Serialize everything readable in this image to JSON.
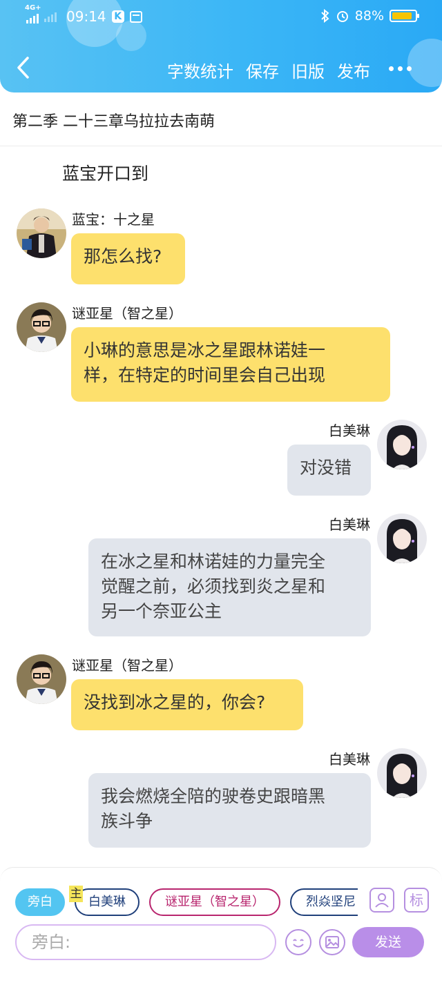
{
  "status_bar": {
    "network": "4G+",
    "time": "09:14",
    "k_icon": "K",
    "battery": "88%",
    "battery_level": 0.88
  },
  "header": {
    "actions": [
      "字数统计",
      "保存",
      "旧版",
      "发布"
    ]
  },
  "chapter_title": "第二季 二十三章乌拉拉去南萌",
  "narration": "蓝宝开口到",
  "messages": [
    {
      "speaker": "蓝宝：十之星",
      "text": "那怎么找?",
      "side": "left"
    },
    {
      "speaker": "谜亚星（智之星）",
      "line1": "小琳的意思是冰之星跟林诺娃一",
      "line2": "样，在特定的时间里会自己出现",
      "side": "left"
    },
    {
      "speaker": "白美琳",
      "text": "对没错",
      "side": "right"
    },
    {
      "speaker": "白美琳",
      "line1": "在冰之星和林诺娃的力量完全",
      "line2": "觉醒之前，必须找到炎之星和",
      "line3": "另一个奈亚公主",
      "side": "right"
    },
    {
      "speaker": "谜亚星（智之星）",
      "text": "没找到冰之星的，你会?",
      "side": "left"
    },
    {
      "speaker": "白美琳",
      "line1": "我会燃烧全陪的驶卷史跟暗黑",
      "line2": "族斗争",
      "side": "right"
    }
  ],
  "composer": {
    "roles": [
      "旁白",
      "白美琳",
      "谜亚星（智之星）",
      "烈焱坚尼"
    ],
    "main_tag": "主",
    "mark_button": "标",
    "input_placeholder": "旁白:",
    "send_label": "发送"
  },
  "colors": {
    "header": "#3bb6f6",
    "left_bubble": "#fde06d",
    "right_bubble": "#e1e5ec",
    "send": "#b98ee8"
  }
}
